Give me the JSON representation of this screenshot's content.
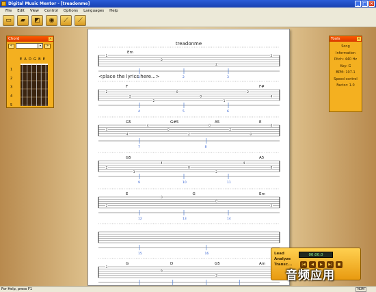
{
  "window": {
    "title": "Digital Music Mentor - [treadonme]",
    "min": "_",
    "max": "□",
    "close": "×"
  },
  "menu": [
    "File",
    "Edit",
    "View",
    "Control",
    "Options",
    "Languages",
    "Help"
  ],
  "toolbar": [
    "open-icon",
    "open-folder-icon",
    "save-icon",
    "tuner-icon",
    "guitar-icon",
    "guitar-tuning-icon"
  ],
  "chord_panel": {
    "title": "Chord",
    "prev": "«",
    "next": "»",
    "dropdown_arrow": "▾",
    "close": "×",
    "strings": "EADGBE",
    "frets": [
      "1",
      "2",
      "3",
      "4",
      "5"
    ]
  },
  "tools_panel": {
    "title": "Tools",
    "close": "×",
    "lines": [
      "Song Information",
      "Pitch: 440 Hz",
      "Key: G",
      "BPM: 107.1",
      "Speed control",
      "Factor: 1.0"
    ]
  },
  "sheet": {
    "title": "treadonme",
    "lyrics_placeholder": "<place the lyrics here...>",
    "rows": [
      {
        "chords": [
          "Em"
        ],
        "notes": [
          "1",
          "0",
          "2",
          "2"
        ],
        "markers": [
          "1",
          "2",
          "3"
        ]
      },
      {
        "chords": [
          "F",
          "F#"
        ],
        "notes": [
          "2",
          "2",
          "2",
          "0",
          "0",
          "1",
          "2",
          "4"
        ],
        "markers": [
          "4",
          "5",
          "6"
        ]
      },
      {
        "chords": [
          "G5",
          "G#5",
          "A5",
          "E"
        ],
        "notes": [
          "3",
          "4",
          "4",
          "0",
          "2",
          "0",
          "2",
          "0",
          "0"
        ],
        "markers": [
          "7",
          "8"
        ]
      },
      {
        "chords": [
          "G5",
          "A5"
        ],
        "notes": [
          "2",
          "3",
          "4",
          "0",
          "2",
          "4",
          "0"
        ],
        "markers": [
          "9",
          "10",
          "11"
        ]
      },
      {
        "chords": [
          "E",
          "G",
          "Em"
        ],
        "notes": [
          "2",
          "0",
          "0",
          "2"
        ],
        "markers": [
          "12",
          "13",
          "14"
        ]
      },
      {
        "chords": [],
        "notes": [],
        "markers": [
          "15",
          "16"
        ]
      },
      {
        "chords": [
          "G",
          "D",
          "G5",
          "Am"
        ],
        "notes": [
          "3",
          "0",
          "3",
          "0"
        ],
        "markers": [
          "17",
          "18",
          "19",
          "20"
        ]
      }
    ]
  },
  "player": {
    "modes": [
      "Lead",
      "Analyze",
      "Transc..."
    ],
    "time": "00:00.0",
    "controls": [
      "|◀",
      "◀",
      "▶",
      "▶|",
      "■"
    ]
  },
  "watermark": "音频应用",
  "status": {
    "text": "For Help, press F1",
    "num": "NUM"
  }
}
